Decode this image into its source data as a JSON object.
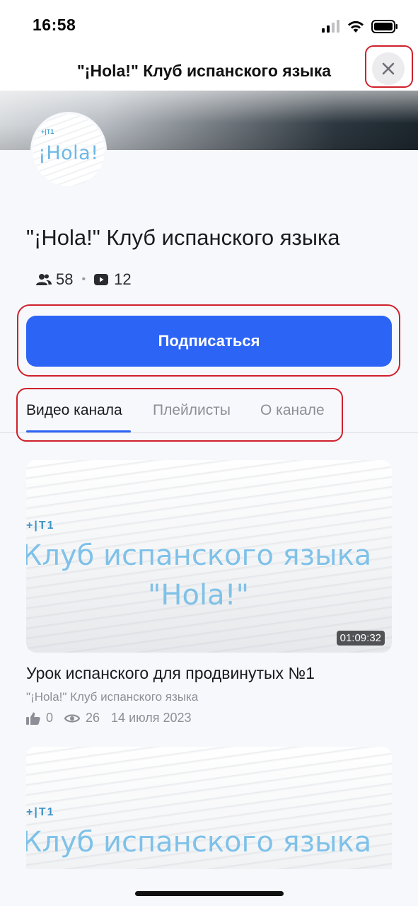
{
  "status_bar": {
    "time": "16:58",
    "icons": [
      "signal-icon",
      "wifi-icon",
      "battery-icon"
    ]
  },
  "header": {
    "title": "\"¡Hola!\" Клуб испанского языка",
    "close_icon": "close-icon"
  },
  "channel": {
    "avatar_caption": "¡Hola!",
    "avatar_brand": "+|T1",
    "name": "\"¡Hola!\" Клуб испанского языка",
    "subscribers": "58",
    "videos": "12",
    "subscribe_label": "Подписаться"
  },
  "tabs": [
    {
      "label": "Видео канала",
      "active": true
    },
    {
      "label": "Плейлисты",
      "active": false
    },
    {
      "label": "О канале",
      "active": false
    }
  ],
  "videos": [
    {
      "thumb_brand": "+|T1",
      "thumb_line1": "Клуб испанского языка",
      "thumb_line2": "\"Hola!\"",
      "duration": "01:09:32",
      "title": "Урок испанского для продвинутых №1",
      "channel": "\"¡Hola!\" Клуб испанского языка",
      "likes": "0",
      "views": "26",
      "date": "14 июля 2023"
    },
    {
      "thumb_brand": "+|T1",
      "thumb_line1": "Клуб испанского языка"
    }
  ],
  "colors": {
    "accent": "#2c64f6",
    "highlight_box": "#d0202b",
    "muted_text": "#8e8e96"
  }
}
